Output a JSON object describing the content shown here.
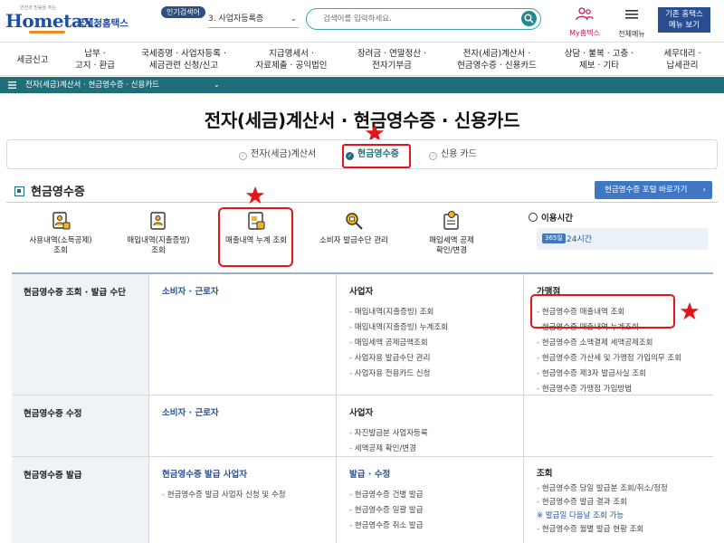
{
  "header": {
    "logo_tagline": "안전과 믿음을 주는",
    "logo_brand": "Hometax.",
    "logo_agency": "국세청홈택스",
    "popular_badge": "인기검색어",
    "popular_select": "3.  사업자등록증",
    "search_placeholder": "검색어를 입력하세요.",
    "my_hometax": "My홈택스",
    "all_menu": "전체메뉴",
    "old_hometax_line1": "기존 홈택스",
    "old_hometax_line2": "메뉴 보기"
  },
  "gnb": [
    {
      "line1": "세금신고",
      "line2": ""
    },
    {
      "line1": "납부 ·",
      "line2": "고지 · 환급"
    },
    {
      "line1": "국세증명 · 사업자등록 ·",
      "line2": "세금관련 신청/신고"
    },
    {
      "line1": "지급명세서 ·",
      "line2": "자료제출 · 공익법인"
    },
    {
      "line1": "장려금 · 연말정산 ·",
      "line2": "전자기부금"
    },
    {
      "line1": "전자(세금)계산서 ·",
      "line2": "현금영수증 · 신용카드"
    },
    {
      "line1": "상담 · 불복 · 고충 ·",
      "line2": "제보 · 기타"
    },
    {
      "line1": "세무대리 ·",
      "line2": "납세관리"
    }
  ],
  "breadcrumb": "전자(세금)계산서 · 현금영수증 · 신용카드",
  "page_title": "전자(세금)계산서 · 현금영수증 · 신용카드",
  "tabs": [
    {
      "label": "전자(세금)계산서",
      "active": false
    },
    {
      "label": "현금영수증",
      "active": true
    },
    {
      "label": "신용 카드",
      "active": false
    }
  ],
  "section": {
    "title": "현금영수증",
    "portal_button": "현금영수증 포털 바로가기"
  },
  "quick_links": [
    {
      "line1": "사용내역(소득공제)",
      "line2": "조회",
      "icon": "receipt-person-icon"
    },
    {
      "line1": "매입내역(지출증빙)",
      "line2": "조회",
      "icon": "purchase-person-icon"
    },
    {
      "line1": "매출내역 누계 조회",
      "line2": "",
      "icon": "sales-document-icon"
    },
    {
      "line1": "소비자 발급수단 관리",
      "line2": "",
      "icon": "magnifier-icon"
    },
    {
      "line1": "매입세액 공제",
      "line2": "확인/변경",
      "icon": "tax-deduction-icon"
    }
  ],
  "usage": {
    "title": "이용시간",
    "badge": "365일",
    "hours": "24시간"
  },
  "table": {
    "rows": [
      {
        "header": "현금영수증 조회 · 발급 수단",
        "cols": [
          {
            "title": "소비자 · 근로자",
            "items": []
          },
          {
            "title": "사업자",
            "items": [
              "매입내역(지출증빙) 조회",
              "매입내역(지출증빙) 누계조회",
              "매입세액 공제금액조회",
              "사업자용 발급수단 관리",
              "사업자용 전용카드 신청"
            ]
          },
          {
            "title": "가맹점",
            "items": [
              "현금영수증 매출내역 조회",
              "현금영수증 매출내역 누계조회",
              "현금영수증 소액결제 세액공제조회",
              "현금영수증 가산세 및 가맹점 가입의무 조회",
              "현금영수증 제3자 발급사실 조회",
              "현금영수증 가맹점 가입방법"
            ]
          }
        ]
      },
      {
        "header": "현금영수증 수정",
        "cols": [
          {
            "title": "소비자 · 근로자",
            "items": []
          },
          {
            "title": "사업자",
            "items": [
              "자진발급분 사업자등록",
              "세액공제 확인/변경"
            ]
          },
          {
            "title": "",
            "items": []
          }
        ]
      },
      {
        "header": "현금영수증 발급",
        "cols": [
          {
            "title": "현금영수증 발급 사업자",
            "items": [
              "현금영수증 발급 사업자 신청 및 수정"
            ]
          },
          {
            "title": "발급 · 수정",
            "items": [
              "현금영수증 건별 발급",
              "현금영수증 일괄 발급",
              "현금영수증 취소 발급"
            ]
          },
          {
            "title": "조회",
            "items": [
              "현금영수증 당일 발급분 조회/취소/정정",
              "현금영수증 발급 결과 조회"
            ],
            "note": "※ 발급일 다음날 조회 가능",
            "items2": [
              "현금영수증 월별 발급 현황 조회"
            ]
          }
        ]
      }
    ]
  },
  "colors": {
    "brand_blue": "#1d4fa6",
    "teal": "#1f6e7a",
    "highlight_red": "#e4141b",
    "link_blue": "#2a5599"
  }
}
